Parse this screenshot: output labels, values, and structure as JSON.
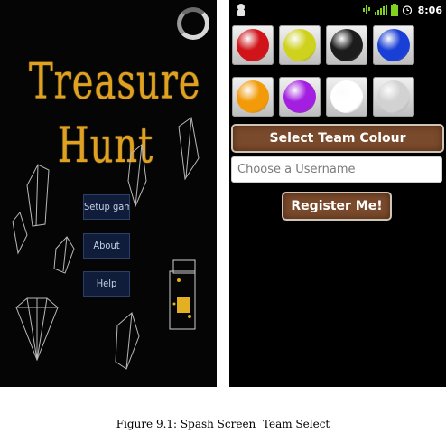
{
  "splash": {
    "title": "Treasure Hunt",
    "menu": [
      {
        "label": "Setup game"
      },
      {
        "label": "About"
      },
      {
        "label": "Help"
      }
    ]
  },
  "team_select": {
    "status_time": "8:06",
    "colours": [
      {
        "name": "red",
        "hex": "#d0141a"
      },
      {
        "name": "yellow",
        "hex": "#cfd21c"
      },
      {
        "name": "black",
        "hex": "#1c1c1c"
      },
      {
        "name": "blue",
        "hex": "#1a3fd6"
      },
      {
        "name": "orange",
        "hex": "#f29a08"
      },
      {
        "name": "purple",
        "hex": "#a31ee0"
      },
      {
        "name": "white",
        "hex": "#ffffff"
      },
      {
        "name": "grey",
        "hex": "#d2d2d2"
      }
    ],
    "select_label": "Select Team Colour",
    "username_placeholder": "Choose a Username",
    "register_label": "Register Me!"
  },
  "caption": "Figure 9.1: Spash Screen  Team Select"
}
